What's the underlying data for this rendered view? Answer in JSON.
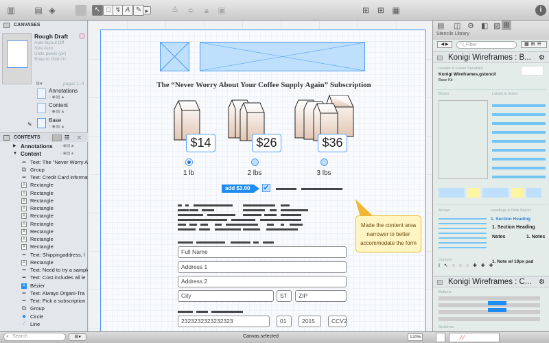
{
  "toolbar": {
    "icons": [
      "sidebar-icon",
      "canvases-icon",
      "layers-icon",
      "style-icon",
      "selection-tool-icon",
      "shape-tool-icon",
      "line-tool-icon",
      "text-tool-icon",
      "pen-tool-icon",
      "browse-tool-icon",
      "bring-front-icon",
      "send-back-icon",
      "lock-icon",
      "group-icon",
      "grid-icon",
      "stencils-icon",
      "inspector-icon",
      "info-icon"
    ]
  },
  "canvases": {
    "header": "CANVASES",
    "name": "Rough Draft",
    "auto_layout": "Auto-layout Off",
    "size": "Size Auto",
    "units": "Units pixels (px)",
    "snap": "Snap to Grid On",
    "pages": "pages 1–4",
    "layers": [
      {
        "name": "Annotations"
      },
      {
        "name": "Content"
      },
      {
        "name": "Base"
      }
    ]
  },
  "contents": {
    "header": "CONTENTS",
    "items": [
      {
        "label": "Annotations",
        "kind": "layer",
        "level": 0,
        "expanded": false
      },
      {
        "label": "Content",
        "kind": "layer",
        "level": 0,
        "expanded": true
      },
      {
        "label": "Text: The \"Never Worry About",
        "kind": "text"
      },
      {
        "label": "Group",
        "kind": "group"
      },
      {
        "label": "Text: Credit Card information",
        "kind": "text"
      },
      {
        "label": "Rectangle",
        "kind": "rect"
      },
      {
        "label": "Rectangle",
        "kind": "rect"
      },
      {
        "label": "Rectangle",
        "kind": "rect"
      },
      {
        "label": "Rectangle",
        "kind": "rect"
      },
      {
        "label": "Rectangle",
        "kind": "rect"
      },
      {
        "label": "Rectangle",
        "kind": "rect"
      },
      {
        "label": "Rectangle",
        "kind": "rect"
      },
      {
        "label": "Rectangle",
        "kind": "rect"
      },
      {
        "label": "Rectangle",
        "kind": "rect"
      },
      {
        "label": "Text: Shippingaddress, l",
        "kind": "text"
      },
      {
        "label": "Rectangle",
        "kind": "rect"
      },
      {
        "label": "Text: Need to try a sample",
        "kind": "text"
      },
      {
        "label": "Text: Cost includes all le",
        "kind": "text"
      },
      {
        "label": "Bézier",
        "kind": "bezier"
      },
      {
        "label": "Text: Always Organi-Tra",
        "kind": "text"
      },
      {
        "label": "Text: Pick a subscription",
        "kind": "text"
      },
      {
        "label": "Group",
        "kind": "group"
      },
      {
        "label": "Circle",
        "kind": "circle"
      },
      {
        "label": "Line",
        "kind": "line"
      }
    ],
    "search_placeholder": "Search"
  },
  "canvas": {
    "title": "The “Never Worry About Your Coffee Supply Again” Subscription",
    "options": [
      {
        "price": "$14",
        "label": "1 lb",
        "selected": true
      },
      {
        "price": "$26",
        "label": "2 lbs",
        "selected": false
      },
      {
        "price": "$36",
        "label": "3 lbs",
        "selected": false
      }
    ],
    "addon_tag": "add $3.00",
    "addon_checked": true,
    "note": "Made the content area narrower to better accommodate the form",
    "fields": {
      "full_name": "Full Name",
      "address1": "Address 1",
      "address2": "Address 2",
      "city": "City",
      "state": "ST",
      "zip": "ZIP",
      "card": "2323232323232323",
      "month": "01",
      "year": "2015",
      "cvv": "CCV2"
    }
  },
  "status": {
    "text": "Canvas selected",
    "zoom": "120%"
  },
  "stencils": {
    "label": "Stencils Library",
    "filter_placeholder": "Filter",
    "set1": {
      "title": "Konigi Wireframes : B...",
      "section1": "Header & Footer Variables",
      "file": "Konigi Wireframes.gstencil",
      "kit": "Base Kit",
      "boxes": "Boxes",
      "labels": "Labels & Notes",
      "arrows": "Arrows",
      "headings": "Headings & Note Blocks",
      "cursors": "Cursors",
      "section_heading": "1. Section Heading",
      "notes": "Notes",
      "note_pad": "1.  Note w/ 10px pad"
    },
    "set2": {
      "title": "Konigi Wireframes : C...",
      "buttons": "Buttons",
      "switches": "Switches"
    }
  },
  "colors": {
    "accent": "#4d9cf5",
    "note_bg": "#fff5c2",
    "note_border": "#f0b830",
    "placeholder_fill": "#bfe0fc"
  }
}
